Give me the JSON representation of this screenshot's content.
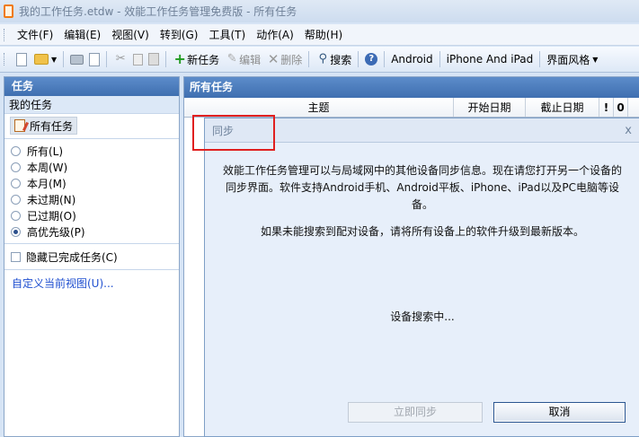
{
  "window": {
    "title": "我的工作任务.etdw - 效能工作任务管理免费版 - 所有任务"
  },
  "menu": [
    {
      "label": "文件(F)",
      "name": "menu-file"
    },
    {
      "label": "编辑(E)",
      "name": "menu-edit"
    },
    {
      "label": "视图(V)",
      "name": "menu-view"
    },
    {
      "label": "转到(G)",
      "name": "menu-goto"
    },
    {
      "label": "工具(T)",
      "name": "menu-tools"
    },
    {
      "label": "动作(A)",
      "name": "menu-action"
    },
    {
      "label": "帮助(H)",
      "name": "menu-help"
    }
  ],
  "toolbar": {
    "new_task": "新任务",
    "edit": "编辑",
    "delete": "删除",
    "search": "搜索",
    "android": "Android",
    "iphone": "iPhone And iPad",
    "theme": "界面风格"
  },
  "left": {
    "header": "任务",
    "sub": "我的任务",
    "all_tasks": "所有任务",
    "filters": [
      {
        "label": "所有(L)",
        "selected": false
      },
      {
        "label": "本周(W)",
        "selected": false
      },
      {
        "label": "本月(M)",
        "selected": false
      },
      {
        "label": "未过期(N)",
        "selected": false
      },
      {
        "label": "已过期(O)",
        "selected": false
      },
      {
        "label": "高优先级(P)",
        "selected": true
      }
    ],
    "hide_completed": "隐藏已完成任务(C)",
    "customize": "自定义当前视图(U)..."
  },
  "main": {
    "header": "所有任务",
    "columns": {
      "subject": "主题",
      "start": "开始日期",
      "due": "截止日期",
      "priority": "!",
      "attach": "0"
    }
  },
  "sync": {
    "title": "同步",
    "close": "x",
    "desc_line1": "效能工作任务管理可以与局域网中的其他设备同步信息。现在请您打开另一个设备的",
    "desc_line2": "同步界面。软件支持Android手机、Android平板、iPhone、iPad以及PC电脑等设",
    "desc_line3": "备。",
    "hint": "如果未能搜索到配对设备，请将所有设备上的软件升级到最新版本。",
    "status": "设备搜索中...",
    "sync_now": "立即同步",
    "cancel": "取消"
  }
}
